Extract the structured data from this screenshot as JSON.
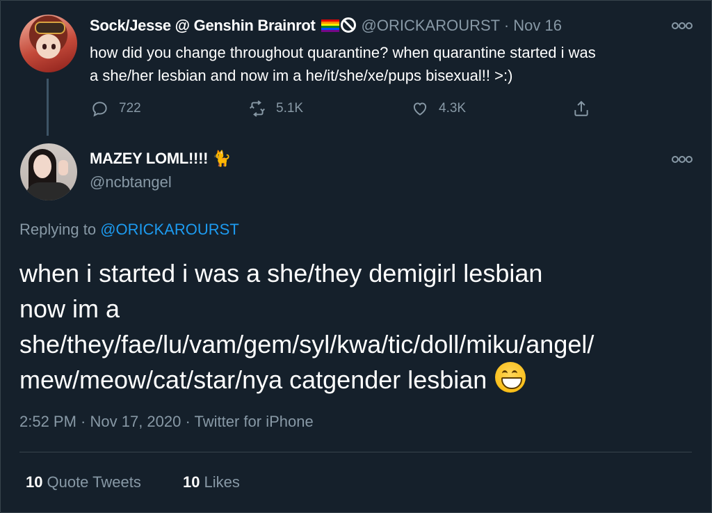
{
  "parent_tweet": {
    "display_name": "Sock/Jesse @ Genshin Brainrot",
    "handle": "@ORICKAROURST",
    "date": "Nov 16",
    "text": "how did you change throughout quarantine? when quarantine started i was\na she/her lesbian and now im a he/it/she/xe/pups bisexual!! >:)",
    "counts": {
      "replies": "722",
      "retweets": "5.1K",
      "likes": "4.3K"
    },
    "icons": [
      "rainbow-flag-icon",
      "no-entry-icon",
      "more-icon",
      "reply-icon",
      "retweet-icon",
      "like-icon",
      "share-icon"
    ]
  },
  "reply_tweet": {
    "display_name": "MAZEY LOML!!!!",
    "name_emoji": "🐈",
    "handle": "@ncbtangel",
    "replying_label": "Replying to",
    "replying_mention": "@ORICKAROURST",
    "text": "when i started i was a she/they demigirl lesbian\nnow im a\nshe/they/fae/lu/vam/gem/syl/kwa/tic/doll/miku/angel/\nmew/meow/cat/star/nya catgender lesbian",
    "meta": "2:52 PM · Nov 17, 2020 · Twitter for iPhone",
    "stats": {
      "quote_tweets_count": "10",
      "quote_tweets_label": "Quote Tweets",
      "likes_count": "10",
      "likes_label": "Likes"
    },
    "icons": [
      "cat-icon",
      "grinning-face-icon",
      "more-icon"
    ]
  },
  "colors": {
    "background": "#15202b",
    "text": "#ffffff",
    "secondary_text": "#8899a6",
    "link": "#1d9bf0",
    "divider": "#38444d"
  }
}
